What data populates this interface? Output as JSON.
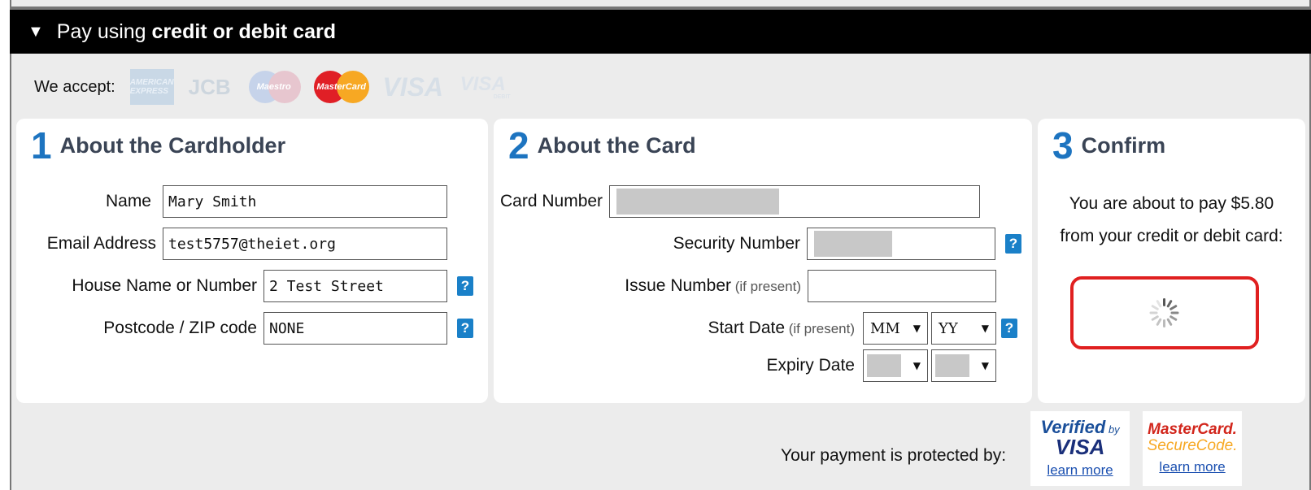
{
  "header": {
    "prefix": "Pay using ",
    "bold": "credit or debit card"
  },
  "accepted_cards": {
    "label": "We accept:",
    "logos": [
      {
        "name": "amex",
        "text": "AMERICAN EXPRESS"
      },
      {
        "name": "jcb",
        "text": "JCB"
      },
      {
        "name": "maestro",
        "text": "Maestro"
      },
      {
        "name": "mastercard",
        "text": "MasterCard"
      },
      {
        "name": "visa",
        "text": "VISA"
      },
      {
        "name": "visa-debit",
        "text": "VISA",
        "sub": "DEBIT"
      }
    ]
  },
  "cardholder": {
    "number": "1",
    "title": "About the Cardholder",
    "name_label": "Name",
    "name_value": "Mary Smith",
    "email_label": "Email Address",
    "email_value": "test5757@theiet.org",
    "house_label": "House Name or Number",
    "house_value": "2 Test Street",
    "postcode_label": "Postcode / ZIP code",
    "postcode_value": "NONE"
  },
  "card": {
    "number": "2",
    "title": "About the Card",
    "card_number_label": "Card Number",
    "card_number_value": "",
    "security_label": "Security Number",
    "security_value": "",
    "issue_label": "Issue Number",
    "issue_sub": " (if present)",
    "issue_value": "",
    "start_label": "Start Date",
    "start_sub": " (if present)",
    "start_month": "MM",
    "start_year": "YY",
    "expiry_label": "Expiry Date",
    "expiry_month": "",
    "expiry_year": ""
  },
  "confirm": {
    "number": "3",
    "title": "Confirm",
    "line1": "You are about to pay  $5.80",
    "line2": "from your credit or debit card:"
  },
  "protection": {
    "label": "Your payment is protected by:",
    "verified_top": "Verified",
    "verified_by": " by",
    "verified_bottom": "VISA",
    "mc_top": "MasterCard.",
    "mc_bottom": "SecureCode.",
    "learn_more": "learn more"
  },
  "help_glyph": "?",
  "colors": {
    "accent": "#1d74c0",
    "header_bg": "#000000",
    "highlight_box": "#e02020"
  }
}
